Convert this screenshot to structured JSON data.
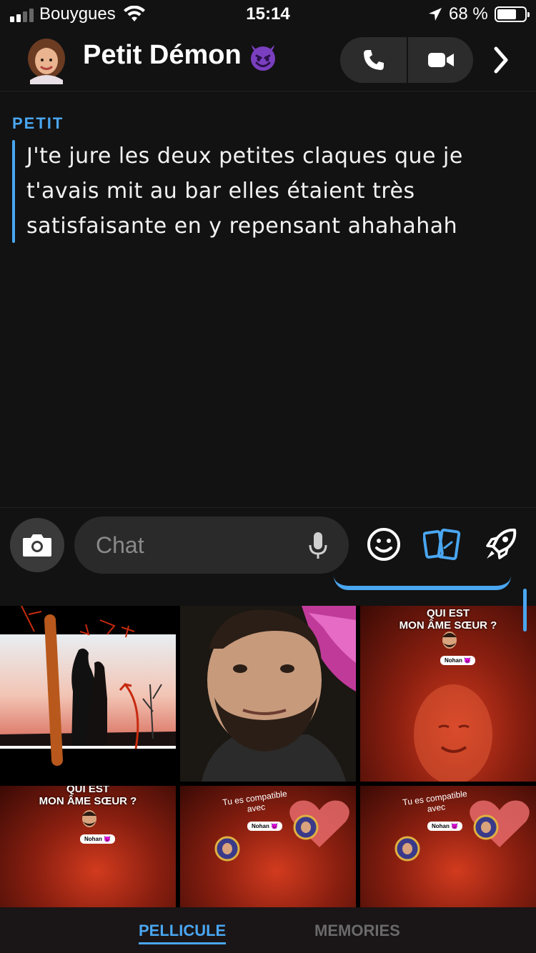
{
  "status_bar": {
    "carrier": "Bouygues",
    "time": "15:14",
    "battery_percent": "68 %"
  },
  "header": {
    "contact_name": "Petit Démon",
    "emoji_icon": "smiling-devil-emoji-icon",
    "call_icon": "phone-icon",
    "video_icon": "video-camera-icon",
    "more_icon": "chevron-right-icon"
  },
  "conversation": {
    "messages": [
      {
        "sender": "PETIT",
        "text": "J'te jure les deux petites claques que je t'avais mit au bar elles étaient très satisfaisante en y repensant ahahahah"
      }
    ]
  },
  "composer": {
    "placeholder": "Chat",
    "camera_icon": "camera-icon",
    "mic_icon": "microphone-icon",
    "emoji_icon": "smiley-icon",
    "cards_icon": "cards-icon",
    "games_icon": "rocket-icon"
  },
  "gallery": {
    "tiles": [
      {
        "caption": ""
      },
      {
        "caption": ""
      },
      {
        "caption": "QUI EST\nMON ÂME SŒUR ?",
        "tag": "Nohan 😈"
      },
      {
        "caption": "QUI EST\nMON ÂME SŒUR ?",
        "tag": "Nohan 😈"
      },
      {
        "caption": "Tu es compatible\navec",
        "tag": "Nohan 😈"
      },
      {
        "caption": "Tu es compatible\navec",
        "tag": "Nohan 😈"
      }
    ]
  },
  "tabs": {
    "camera_roll": "PELLICULE",
    "memories": "MEMORIES"
  },
  "colors": {
    "accent": "#4aa6f0",
    "background": "#121212"
  }
}
